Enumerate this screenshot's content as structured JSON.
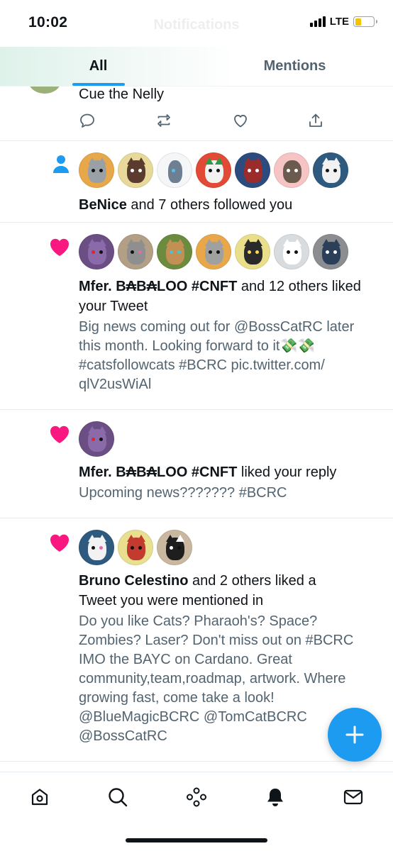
{
  "status": {
    "time": "10:02",
    "network": "LTE",
    "battery_color": "#f5c400"
  },
  "header": {
    "title": "Notifications"
  },
  "tabs": [
    {
      "label": "All",
      "active": true
    },
    {
      "label": "Mentions",
      "active": false
    }
  ],
  "colors": {
    "accent": "#1d9bf0",
    "like": "#f91880",
    "text": "#0f1419",
    "secondary": "#536471"
  },
  "notifications": [
    {
      "kind": "tweet-partial",
      "text": "Cue the Nelly",
      "actions": [
        "reply-icon",
        "retweet-icon",
        "like-icon",
        "share-icon"
      ]
    },
    {
      "kind": "follow",
      "icon": "person-icon",
      "avatar_count": 7,
      "name": "BeNice",
      "rest": " and 7 others followed you"
    },
    {
      "kind": "like",
      "icon": "heart-icon",
      "avatar_count": 7,
      "name": "Mfer. B₳B₳LOO #CNFT",
      "rest": " and 12 others liked your Tweet",
      "tweet_lines": [
        "Big news coming out for @BossCatRC later",
        "this month. Looking forward to it💸💸",
        "#catsfollowcats #BCRC pic.twitter.com/",
        "qlV2usWiAl"
      ]
    },
    {
      "kind": "like",
      "icon": "heart-icon",
      "avatar_count": 1,
      "name": "Mfer. B₳B₳LOO #CNFT",
      "rest": " liked your reply",
      "tweet_lines": [
        "Upcoming news??????? #BCRC"
      ]
    },
    {
      "kind": "like",
      "icon": "heart-icon",
      "avatar_count": 3,
      "name": "Bruno Celestino",
      "rest": " and 2 others liked a",
      "rest2": "Tweet you were mentioned in",
      "tweet_lines": [
        "Do you like Cats? Pharaoh's? Space?",
        "Zombies? Laser? Don't miss out on #BCRC",
        "IMO the BAYC on Cardano. Great",
        "community,team,roadmap, artwork. Where",
        "growing fast, come take a look!",
        "@BlueMagicBCRC @TomCatBCRC",
        "@BossCatRC"
      ]
    }
  ],
  "fab": {
    "icon": "plus-icon"
  },
  "bottom_nav": [
    "home-icon",
    "search-icon",
    "spaces-icon",
    "notifications-icon",
    "messages-icon"
  ]
}
